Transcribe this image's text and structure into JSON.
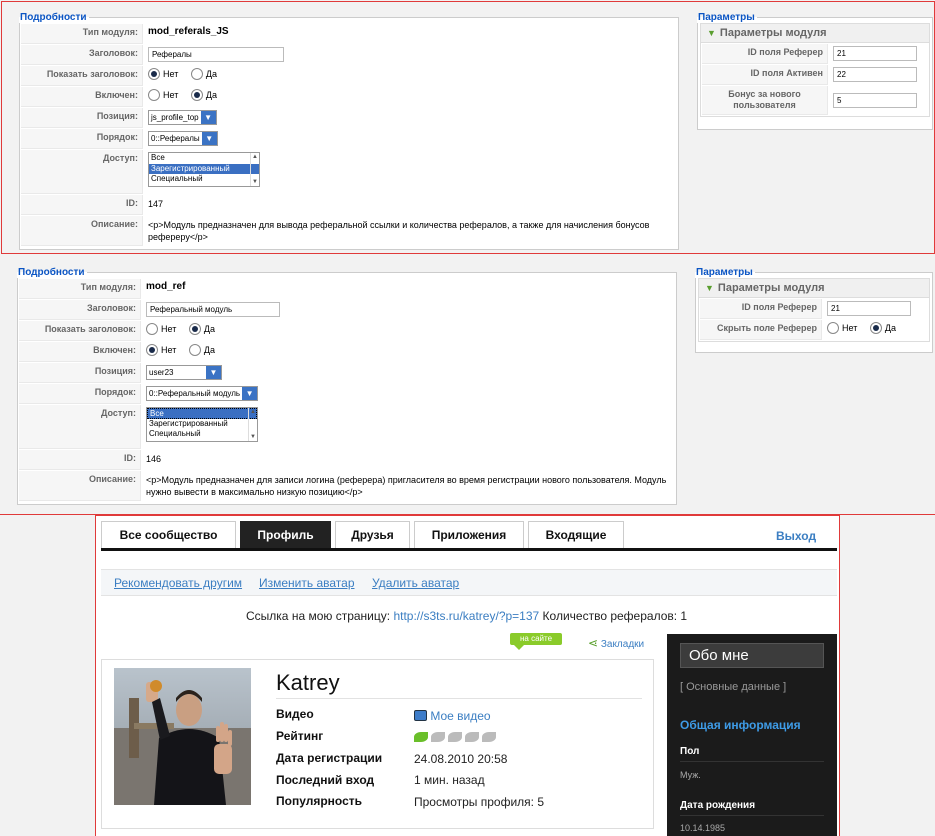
{
  "panel1": {
    "details_legend": "Подробности",
    "rows": {
      "type_label": "Тип модуля:",
      "type_value": "mod_referals_JS",
      "title_label": "Заголовок:",
      "title_value": "Рефералы",
      "show_title_label": "Показать заголовок:",
      "show_title_no": "Нет",
      "show_title_yes": "Да",
      "enabled_label": "Включен:",
      "enabled_no": "Нет",
      "enabled_yes": "Да",
      "position_label": "Позиция:",
      "position_value": "js_profile_top",
      "order_label": "Порядок:",
      "order_value": "0::Рефералы",
      "access_label": "Доступ:",
      "access_options": [
        "Все",
        "Зарегистрированный",
        "Специальный"
      ],
      "id_label": "ID:",
      "id_value": "147",
      "desc_label": "Описание:",
      "desc_value": "<p>Модуль предназначен для вывода реферальной ссылки и количества рефералов, а также для начисления бонусов рефереру</p>"
    },
    "params_legend": "Параметры",
    "params_header": "Параметры модуля",
    "params": {
      "p1_label": "ID поля Реферер",
      "p1_value": "21",
      "p2_label": "ID поля Активен",
      "p2_value": "22",
      "p3_label": "Бонус за нового пользователя",
      "p3_value": "5"
    }
  },
  "panel2": {
    "details_legend": "Подробности",
    "rows": {
      "type_label": "Тип модуля:",
      "type_value": "mod_ref",
      "title_label": "Заголовок:",
      "title_value": "Реферальный модуль",
      "show_title_label": "Показать заголовок:",
      "show_title_no": "Нет",
      "show_title_yes": "Да",
      "enabled_label": "Включен:",
      "enabled_no": "Нет",
      "enabled_yes": "Да",
      "position_label": "Позиция:",
      "position_value": "user23",
      "order_label": "Порядок:",
      "order_value": "0::Реферальный модуль",
      "access_label": "Доступ:",
      "access_options": [
        "Все",
        "Зарегистрированный",
        "Специальный"
      ],
      "id_label": "ID:",
      "id_value": "146",
      "desc_label": "Описание:",
      "desc_value": "<p>Модуль предназначен для записи логина (реферера) пригласителя во время регистрации нового пользователя. Модуль нужно вывести в максимально низкую позицию</p>"
    },
    "params_legend": "Параметры",
    "params_header": "Параметры модуля",
    "params": {
      "p1_label": "ID поля Реферер",
      "p1_value": "21",
      "p2_label": "Скрыть поле Реферер",
      "p2_no": "Нет",
      "p2_yes": "Да"
    }
  },
  "site": {
    "tabs": [
      "Все сообщество",
      "Профиль",
      "Друзья",
      "Приложения",
      "Входящие"
    ],
    "logout": "Выход",
    "actions": [
      "Рекомендовать другим",
      "Изменить аватар",
      "Удалить аватар"
    ],
    "ref_text": "Ссылка на мою страницу:",
    "ref_link": "http://s3ts.ru/katrey/?p=137",
    "ref_count": "Количество рефералов: 1",
    "online_badge": "на сайте",
    "bookmarks": "Закладки",
    "username": "Katrey",
    "fields": {
      "video_label": "Видео",
      "video_value": "Мое видео",
      "rating_label": "Рейтинг",
      "reg_label": "Дата регистрации",
      "reg_value": "24.08.2010 20:58",
      "last_label": "Последний вход",
      "last_value": "1 мин. назад",
      "pop_label": "Популярность",
      "pop_value": "Просмотры профиля: 5"
    },
    "sidebar": {
      "about": "Обо мне",
      "basic": "[ Основные данные ]",
      "general": "Общая информация",
      "sex_label": "Пол",
      "sex_value": "Муж.",
      "dob_label": "Дата рождения",
      "dob_value": "10.14.1985"
    },
    "colors": {
      "link": "#3b7ec2",
      "accent_green": "#8acb2a",
      "sidebar_bg": "#1b1b1b"
    }
  }
}
